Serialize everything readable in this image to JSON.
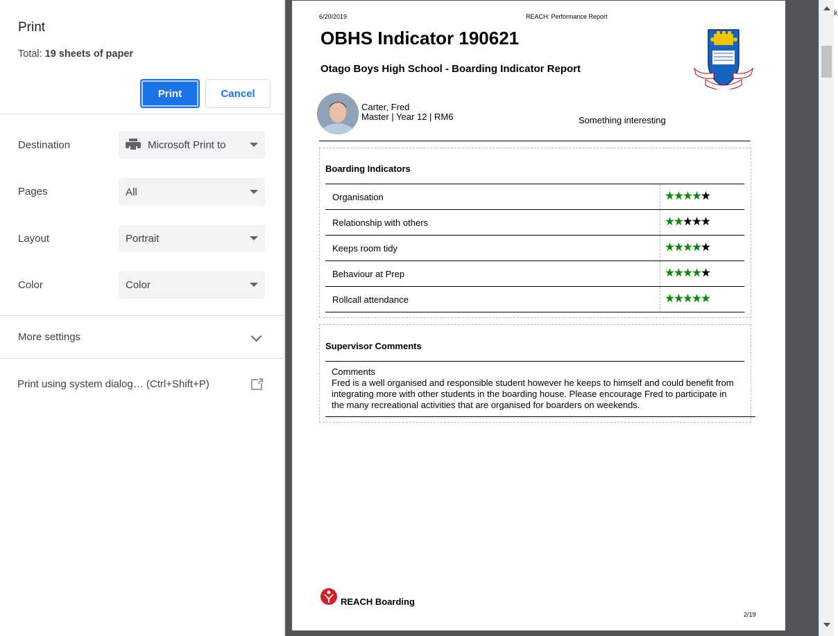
{
  "dialog": {
    "title": "Print",
    "total_label": "Total:",
    "total_value": "19 sheets of paper",
    "print_label": "Print",
    "cancel_label": "Cancel",
    "accent_color": "#1a73e8"
  },
  "settings": {
    "destination": {
      "label": "Destination",
      "value": "Microsoft Print to",
      "icon": "printer-icon"
    },
    "pages": {
      "label": "Pages",
      "value": "All"
    },
    "layout": {
      "label": "Layout",
      "value": "Portrait"
    },
    "color": {
      "label": "Color",
      "value": "Color"
    },
    "more_settings": "More settings",
    "system_dialog": "Print using system dialog… (Ctrl+Shift+P)"
  },
  "report": {
    "date": "6/20/2019",
    "header_title": "REACH: Performance Report",
    "title": "OBHS Indicator 190621",
    "subtitle": "Otago Boys High School - Boarding Indicator Report",
    "student_name": "Carter, Fred",
    "student_info": "Master | Year 12 | RM6",
    "note": "Something interesting",
    "indicators_title": "Boarding Indicators",
    "indicators": [
      {
        "label": "Organisation",
        "rating": 4
      },
      {
        "label": "Relationship with others",
        "rating": 2
      },
      {
        "label": "Keeps room tidy",
        "rating": 4
      },
      {
        "label": "Behaviour at Prep",
        "rating": 4
      },
      {
        "label": "Rollcall attendance",
        "rating": 5
      }
    ],
    "max_rating": 5,
    "star_on_color": "#0a8a0a",
    "star_off_color": "#000000",
    "comments_title": "Supervisor Comments",
    "comments_label": "Comments",
    "comments_text": "Fred is a well organised and responsible student however he keeps to himself and could benefit from integrating more with other students in the boarding house. Please encourage Fred to participate in the many recreational activities that are organised for boarders on weekends.",
    "footer_brand": "REACH Boarding",
    "page_number": "2/19"
  },
  "edge_text": "k"
}
